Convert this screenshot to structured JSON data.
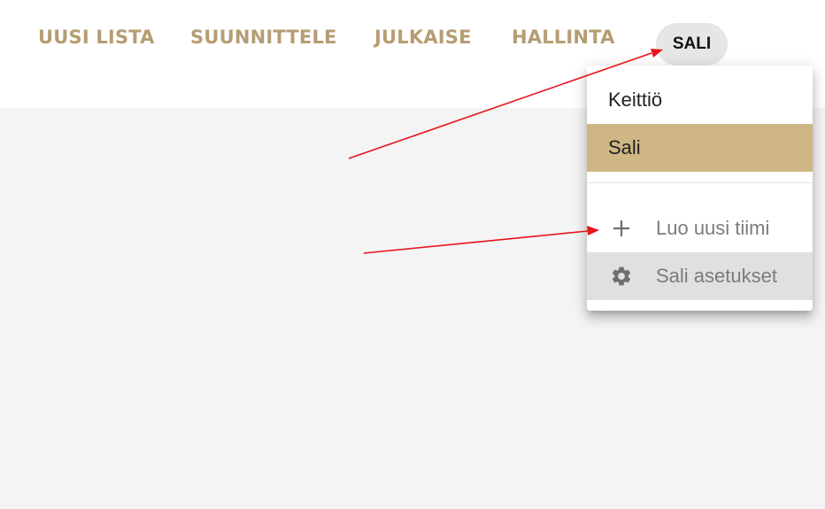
{
  "nav": {
    "items": [
      {
        "label": "UUSI LISTA"
      },
      {
        "label": "SUUNNITTELE"
      },
      {
        "label": "JULKAISE"
      },
      {
        "label": "HALLINTA"
      }
    ],
    "team_chip": "SALI"
  },
  "team_menu": {
    "teams": [
      {
        "label": "Keittiö",
        "selected": false
      },
      {
        "label": "Sali",
        "selected": true
      }
    ],
    "actions": [
      {
        "label": "Luo uusi tiimi",
        "icon": "plus-icon"
      },
      {
        "label": "Sali asetukset",
        "icon": "gear-icon"
      }
    ]
  },
  "colors": {
    "nav_text": "#b59d72",
    "selected_bg": "#cfb785",
    "annotation_arrow": "#e8141b",
    "page_bg": "#f4f4f4"
  }
}
